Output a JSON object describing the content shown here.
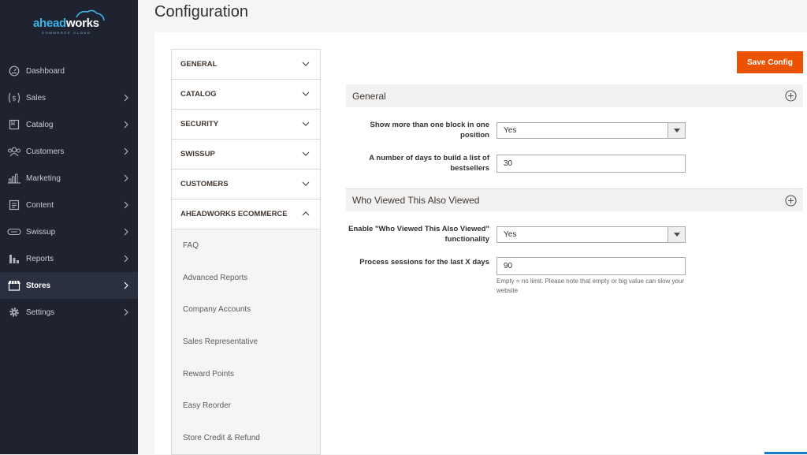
{
  "logo": {
    "brand_part1": "ahead",
    "brand_part2": "works",
    "tagline": "COMMERCE CLOUD",
    "cloud_color": "#3fb2e6"
  },
  "sidebar": {
    "items": [
      {
        "label": "Dashboard",
        "icon": "dashboard-icon",
        "chevron": false,
        "active": false
      },
      {
        "label": "Sales",
        "icon": "dollar-icon",
        "chevron": true,
        "active": false
      },
      {
        "label": "Catalog",
        "icon": "catalog-icon",
        "chevron": true,
        "active": false
      },
      {
        "label": "Customers",
        "icon": "customers-icon",
        "chevron": true,
        "active": false
      },
      {
        "label": "Marketing",
        "icon": "marketing-icon",
        "chevron": true,
        "active": false
      },
      {
        "label": "Content",
        "icon": "content-icon",
        "chevron": true,
        "active": false
      },
      {
        "label": "Swissup",
        "icon": "swissup-icon",
        "chevron": true,
        "active": false
      },
      {
        "label": "Reports",
        "icon": "reports-icon",
        "chevron": true,
        "active": false
      },
      {
        "label": "Stores",
        "icon": "stores-icon",
        "chevron": true,
        "active": true
      },
      {
        "label": "Settings",
        "icon": "gear-icon",
        "chevron": true,
        "active": false
      }
    ]
  },
  "page": {
    "title": "Configuration"
  },
  "toolbar": {
    "save_label": "Save Config",
    "save_color": "#eb5202"
  },
  "config_nav": {
    "sections": [
      {
        "label": "GENERAL",
        "expanded": false
      },
      {
        "label": "CATALOG",
        "expanded": false
      },
      {
        "label": "SECURITY",
        "expanded": false
      },
      {
        "label": "SWISSUP",
        "expanded": false
      },
      {
        "label": "CUSTOMERS",
        "expanded": false
      },
      {
        "label": "AHEADWORKS ECOMMERCE",
        "expanded": true
      }
    ],
    "subitems": [
      "FAQ",
      "Advanced Reports",
      "Company Accounts",
      "Sales Representative",
      "Reward Points",
      "Easy Reorder",
      "Store Credit & Refund"
    ]
  },
  "groups": [
    {
      "title": "General",
      "fields": [
        {
          "label": "Show more than one block in one position",
          "type": "select",
          "value": "Yes"
        },
        {
          "label": "A number of days to build a list of bestsellers",
          "type": "text",
          "value": "30"
        }
      ]
    },
    {
      "title": "Who Viewed This Also Viewed",
      "fields": [
        {
          "label": "Enable \"Who Viewed This Also Viewed\" functionality",
          "type": "select",
          "value": "Yes"
        },
        {
          "label": "Process sessions for the last X days",
          "type": "text",
          "value": "90",
          "note": "Empty = no limit. Please note that empty or big value can slow your website"
        }
      ]
    }
  ]
}
